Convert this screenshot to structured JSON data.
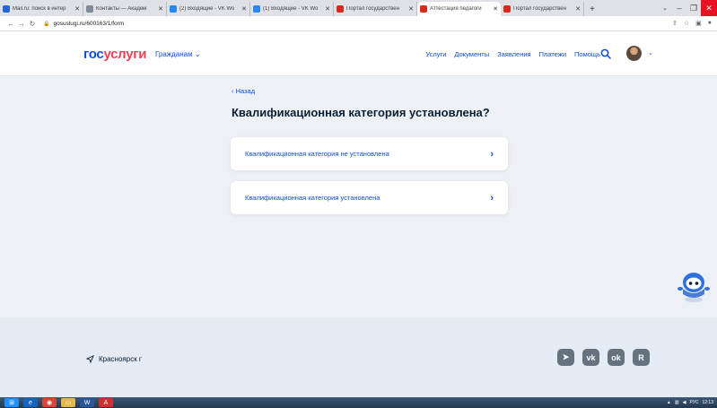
{
  "browser": {
    "tabs": [
      {
        "title": "Mail.ru: поиск в интер",
        "active": false,
        "color": "#2b64d6"
      },
      {
        "title": "Контакты — Академ",
        "active": false,
        "color": "#7c8a99"
      },
      {
        "title": "(2) Входящие - VK Wo",
        "active": false,
        "color": "#2787f5"
      },
      {
        "title": "(1) Входящие - VK Wo",
        "active": false,
        "color": "#2787f5"
      },
      {
        "title": "Портал государствен",
        "active": false,
        "color": "#d52b1e"
      },
      {
        "title": "Аттестация педагоги",
        "active": true,
        "color": "#d52b1e"
      },
      {
        "title": "Портал государствен",
        "active": false,
        "color": "#d52b1e"
      }
    ],
    "new_tab": "+",
    "url": "gosuslugi.ru/600163/1/form"
  },
  "header": {
    "logo_part1": "гос",
    "logo_part2": "услуги",
    "citizens": "Гражданам ⌄",
    "nav": [
      "Услуги",
      "Документы",
      "Заявления",
      "Платежи",
      "Помощь"
    ]
  },
  "main": {
    "back": "‹ Назад",
    "question": "Квалификационная категория установлена?",
    "options": [
      {
        "label": "Квалификационная категория не установлена"
      },
      {
        "label": "Квалификационная категория установлена"
      }
    ],
    "chevron": "›"
  },
  "footer": {
    "location": "Красноярск г",
    "socials": [
      "telegram",
      "vk",
      "odnoklassniki",
      "rutube"
    ]
  },
  "taskbar": {
    "lang": "РУС",
    "time": "12:13"
  },
  "colors": {
    "brand_blue": "#0d4cd3",
    "brand_red": "#ee3f58",
    "page_bg": "#edf1f6",
    "footer_bg": "#e4ebf3"
  }
}
